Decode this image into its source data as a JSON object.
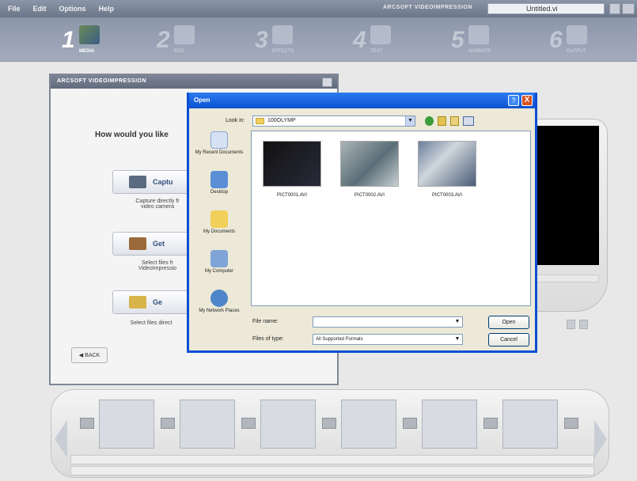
{
  "menu": [
    "File",
    "Edit",
    "Options",
    "Help"
  ],
  "app_title": "ARCSOFT VIDEOIMPRESSION",
  "project_name": "Untitled.vi",
  "steps": [
    {
      "num": "1",
      "label": "MEDIA"
    },
    {
      "num": "2",
      "label": "EDIT"
    },
    {
      "num": "3",
      "label": "EFFECTS"
    },
    {
      "num": "4",
      "label": "TEXT"
    },
    {
      "num": "5",
      "label": "NARRATE"
    },
    {
      "num": "6",
      "label": "OUTPUT"
    }
  ],
  "inner_window": {
    "title": "ARCSOFT VIDEOIMPRESSION",
    "question": "How would you like",
    "capture_label": "Captu",
    "capture_desc": "Capture directly fr\nvideo camera",
    "get_label": "Get",
    "get_desc": "Select files fr\nVideoImpressio",
    "get2_label": "Ge",
    "get2_desc": "Select files direct",
    "back_label": "BACK"
  },
  "dialog": {
    "title": "Open",
    "help": "?",
    "close": "X",
    "look_in_label": "Look in:",
    "look_in_value": "100OLYMP",
    "places": [
      "My Recent Documents",
      "Desktop",
      "My Documents",
      "My Computer",
      "My Network Places"
    ],
    "files": [
      "PICT0001.AVI",
      "PICT0002.AVI",
      "PICT0003.AVI"
    ],
    "file_name_label": "File name:",
    "file_name_value": "",
    "files_of_type_label": "Files of type:",
    "files_of_type_value": "All Supported Formats",
    "open_button": "Open",
    "cancel_button": "Cancel"
  }
}
